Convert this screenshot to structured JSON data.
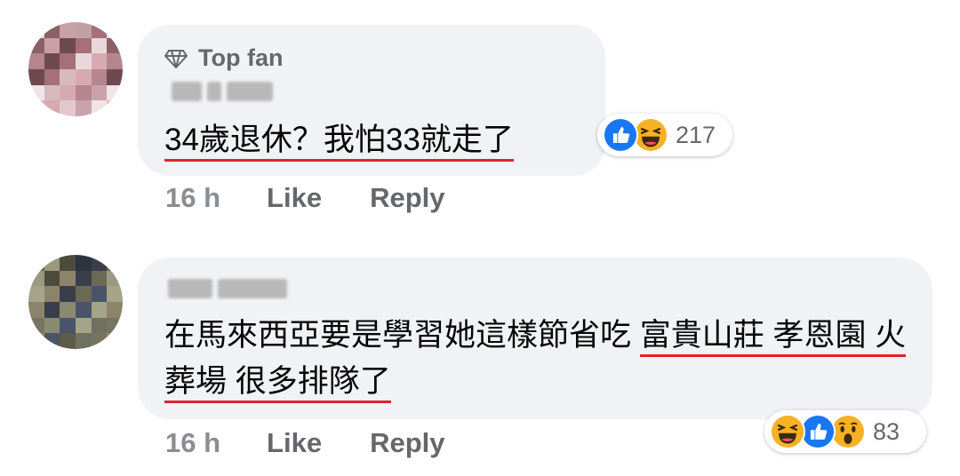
{
  "comments": [
    {
      "badge": "Top fan",
      "text_before": "34歲退休？我怕33就走了",
      "reaction_count": "217",
      "reactions": [
        "like-icon",
        "haha-icon"
      ],
      "time": "16 h",
      "like_label": "Like",
      "reply_label": "Reply"
    },
    {
      "text_part1": "在馬來西亞要是學習她這樣節省吃 ",
      "text_part2": "富貴山莊 孝恩園 火葬場 很多排隊了",
      "reaction_count": "83",
      "reactions": [
        "haha-icon",
        "like-icon",
        "wow-icon"
      ],
      "time": "16 h",
      "like_label": "Like",
      "reply_label": "Reply"
    }
  ],
  "colors": {
    "bubble": "#f0f2f5",
    "underline": "#e0242e",
    "like_blue": "#1877f2",
    "emoji_yellow": "#f7b125",
    "meta_gray": "#65676b"
  }
}
